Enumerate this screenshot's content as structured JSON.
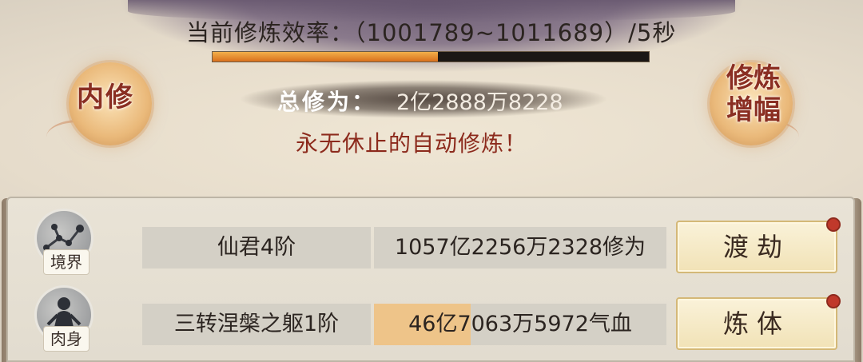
{
  "header": {
    "rate_label": "当前修炼效率：",
    "rate_value": "（1001789~1011689）/5秒",
    "progress_fraction": 0.516
  },
  "badges": {
    "left_label": "内修",
    "right_label_line1": "修炼",
    "right_label_line2": "增幅"
  },
  "total": {
    "label": "总修为：",
    "value": "2亿2888万8228"
  },
  "auto_text": "永无休止的自动修炼！",
  "rows": [
    {
      "icon_label": "境界",
      "name": "仙君4阶",
      "value": "1057亿2256万2328修为",
      "value_fill_fraction": 0,
      "button_label": "渡劫"
    },
    {
      "icon_label": "肉身",
      "name": "三转涅槃之躯1阶",
      "value": "46亿7063万5972气血",
      "value_fill_fraction": 0.33,
      "button_label": "炼体"
    }
  ],
  "colors": {
    "accent_red": "#8c2a1c",
    "progress_fill": "#e08a2a",
    "button_bg": "#f1e2b6"
  }
}
